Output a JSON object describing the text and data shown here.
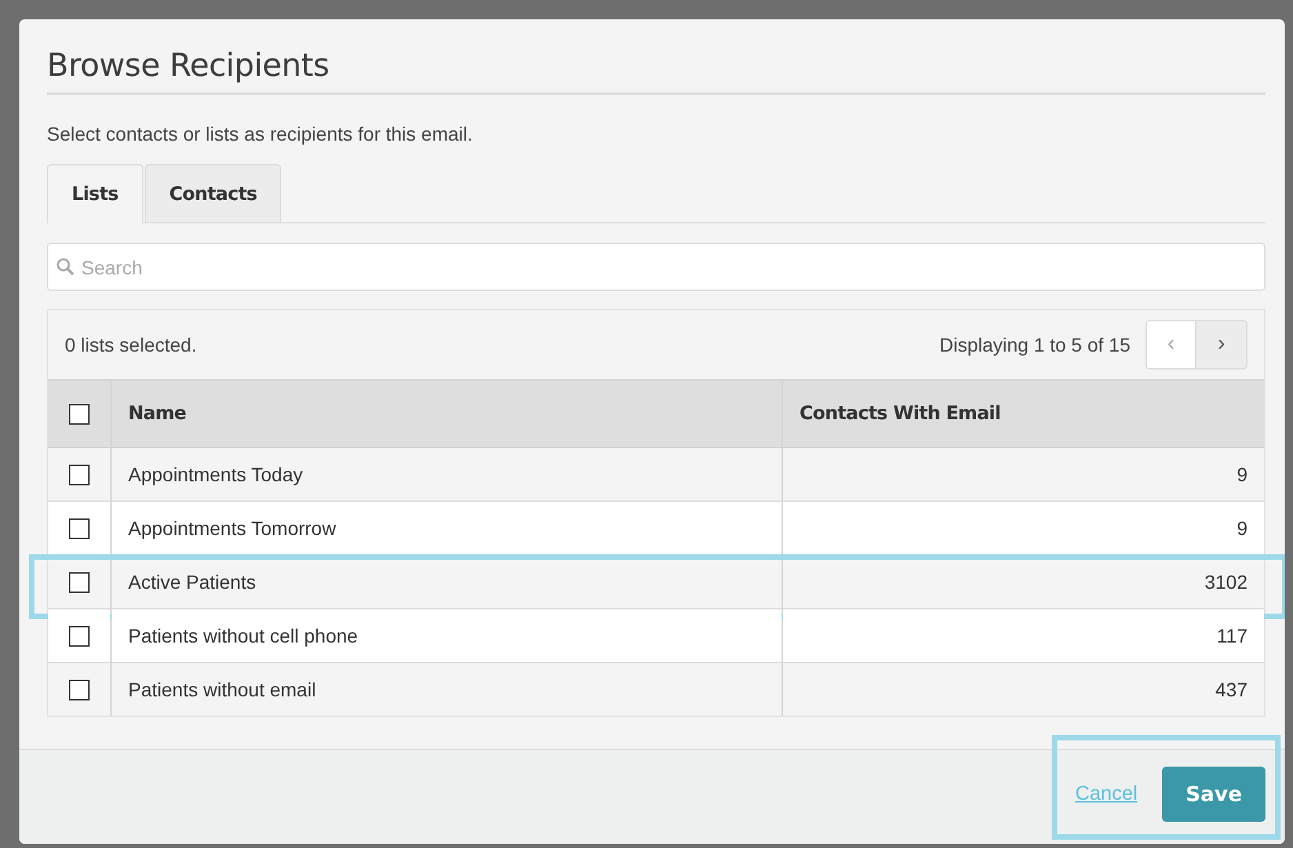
{
  "dialog": {
    "title": "Browse Recipients",
    "description": "Select contacts or lists as recipients for this email."
  },
  "tabs": [
    {
      "label": "Lists",
      "selected": true
    },
    {
      "label": "Contacts",
      "selected": false
    }
  ],
  "search": {
    "placeholder": "Search"
  },
  "selection_summary": "0 lists selected.",
  "pagination": {
    "text": "Displaying 1 to 5 of 15",
    "previous": "‹",
    "next": "›",
    "previous_disabled": true
  },
  "table": {
    "select_all_checked": false,
    "columns": [
      "Name",
      "Contacts With Email"
    ],
    "rows": [
      {
        "name": "Appointments Today",
        "count": "9",
        "checked": false,
        "highlighted": false
      },
      {
        "name": "Appointments Tomorrow",
        "count": "9",
        "checked": false,
        "highlighted": false
      },
      {
        "name": "Active Patients",
        "count": "3102",
        "checked": false,
        "highlighted": true
      },
      {
        "name": "Patients without cell phone",
        "count": "117",
        "checked": false,
        "highlighted": false
      },
      {
        "name": "Patients without email",
        "count": "437",
        "checked": false,
        "highlighted": false
      }
    ]
  },
  "footer": {
    "cancel": "Cancel",
    "save": "Save",
    "highlighted": true
  }
}
